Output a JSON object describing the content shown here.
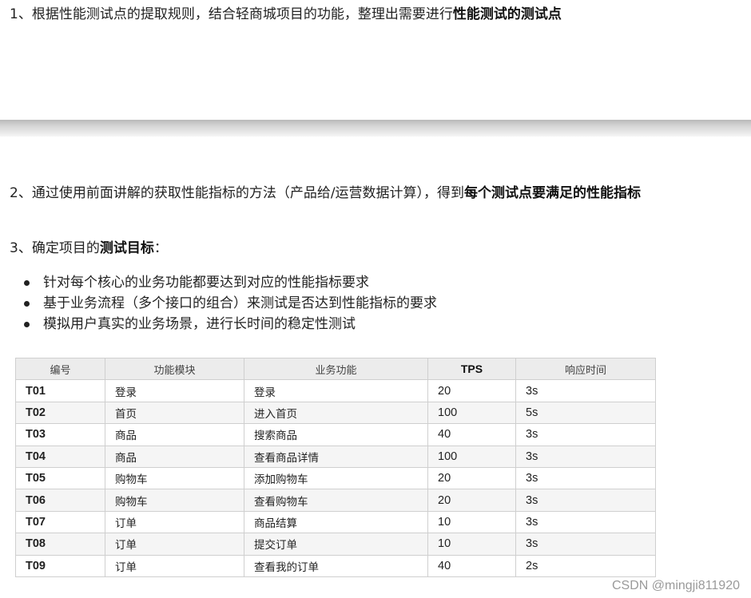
{
  "section1": {
    "prefix": "1、根据性能测试点的提取规则，结合轻商城项目的功能，整理出需要进行",
    "bold": "性能测试的测试点"
  },
  "section2": {
    "prefix": "2、通过使用前面讲解的获取性能指标的方法（产品给/运营数据计算），得到",
    "bold": "每个测试点要满足的性能指标"
  },
  "section3": {
    "prefix": "3、确定项目的",
    "bold": "测试目标",
    "suffix": "："
  },
  "goals": [
    "针对每个核心的业务功能都要达到对应的性能指标要求",
    "基于业务流程（多个接口的组合）来测试是否达到性能指标的要求",
    "模拟用户真实的业务场景，进行长时间的稳定性测试"
  ],
  "table": {
    "headers": [
      "编号",
      "功能模块",
      "业务功能",
      "TPS",
      "响应时间"
    ],
    "rows": [
      [
        "T01",
        "登录",
        "登录",
        "20",
        "3s"
      ],
      [
        "T02",
        "首页",
        "进入首页",
        "100",
        "5s"
      ],
      [
        "T03",
        "商品",
        "搜索商品",
        "40",
        "3s"
      ],
      [
        "T04",
        "商品",
        "查看商品详情",
        "100",
        "3s"
      ],
      [
        "T05",
        "购物车",
        "添加购物车",
        "20",
        "3s"
      ],
      [
        "T06",
        "购物车",
        "查看购物车",
        "20",
        "3s"
      ],
      [
        "T07",
        "订单",
        "商品结算",
        "10",
        "3s"
      ],
      [
        "T08",
        "订单",
        "提交订单",
        "10",
        "3s"
      ],
      [
        "T09",
        "订单",
        "查看我的订单",
        "40",
        "2s"
      ]
    ]
  },
  "watermark": "CSDN @mingji811920"
}
